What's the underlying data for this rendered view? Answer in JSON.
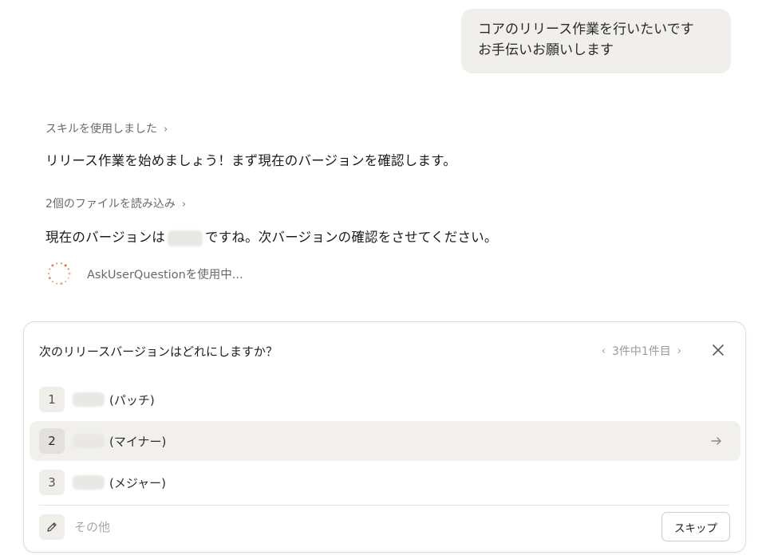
{
  "user_message": {
    "line1": "コアのリリース作業を行いたいです",
    "line2": "お手伝いお願いします"
  },
  "transcript": {
    "skill_link": "スキルを使用しました",
    "line1": "リリース作業を始めましょう！まず現在のバージョンを確認します。",
    "files_link": "2個のファイルを読み込み",
    "line2_before": "現在のバージョンは",
    "line2_after": "ですね。次バージョンの確認をさせてください。",
    "tool_status": "AskUserQuestionを使用中...",
    "chevron": "›"
  },
  "question_panel": {
    "title": "次のリリースバージョンはどれにしますか？",
    "pager": "3件中1件目",
    "prev": "‹",
    "next": "›",
    "options": [
      {
        "number": "1",
        "label": "(パッチ)"
      },
      {
        "number": "2",
        "label": "(マイナー)",
        "selected": true
      },
      {
        "number": "3",
        "label": "(メジャー)"
      }
    ],
    "other_placeholder": "その他",
    "skip_label": "スキップ"
  },
  "colors": {
    "spinner": "#d9603b",
    "bubble_bg": "#f0efeb",
    "selected_bg": "#f1f0ec"
  }
}
